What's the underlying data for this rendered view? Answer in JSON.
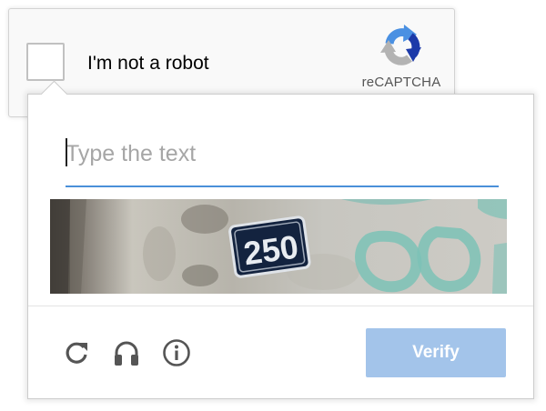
{
  "anchor": {
    "checkbox_checked": false,
    "label": "I'm not a robot",
    "logo_text": "reCAPTCHA",
    "logo_icon": "recaptcha-logo-icon"
  },
  "challenge": {
    "input": {
      "placeholder": "Type the text",
      "value": ""
    },
    "image_text": "250",
    "toolbar": {
      "reload_icon": "reload-icon",
      "audio_icon": "headphones-icon",
      "info_icon": "info-icon",
      "verify_label": "Verify"
    }
  },
  "colors": {
    "accent": "#4a90d9",
    "verify_bg": "#a3c4ea",
    "logo_blue": "#1c3aa9",
    "logo_light_blue": "#4a90e2",
    "logo_gray": "#b3b3b3",
    "icon_gray": "#555555"
  }
}
